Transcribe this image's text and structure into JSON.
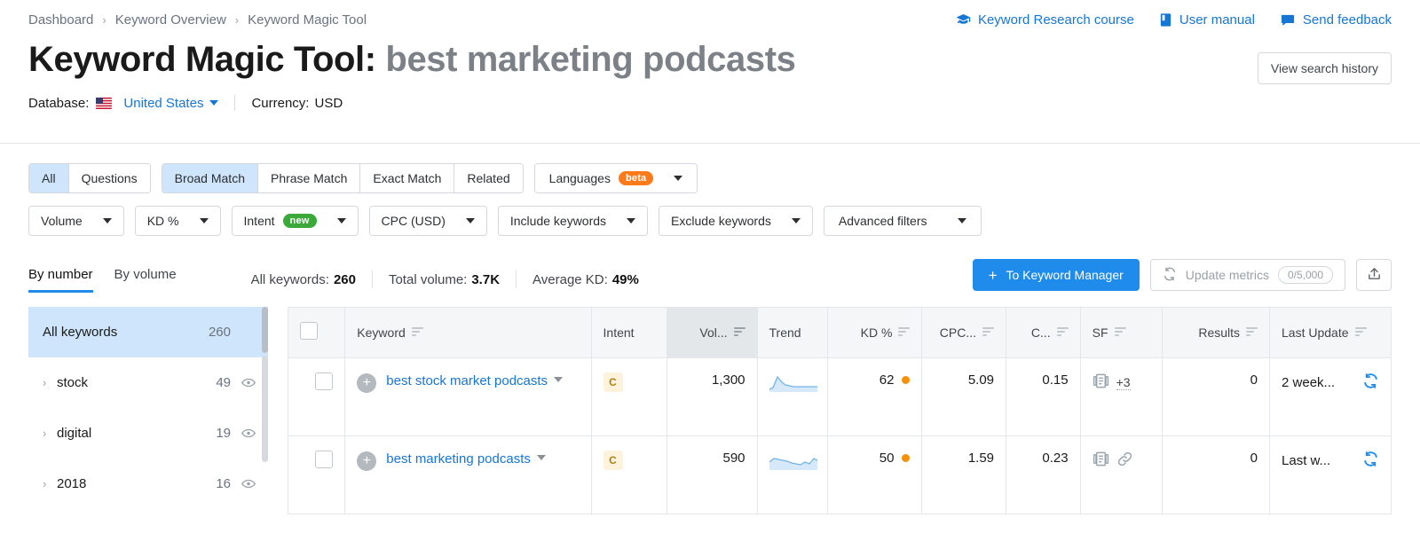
{
  "breadcrumb": {
    "items": [
      {
        "label": "Dashboard"
      },
      {
        "label": "Keyword Overview"
      },
      {
        "label": "Keyword Magic Tool"
      }
    ],
    "separator": "›"
  },
  "top_links": [
    {
      "label": "Keyword Research course",
      "icon": "graduation-cap-icon"
    },
    {
      "label": "User manual",
      "icon": "book-icon"
    },
    {
      "label": "Send feedback",
      "icon": "chat-bubble-icon"
    }
  ],
  "header": {
    "title_label": "Keyword Magic Tool:",
    "title_query": "best marketing podcasts",
    "search_history_button": "View search history",
    "database_label": "Database:",
    "database_value": "United States",
    "currency_label": "Currency:",
    "currency_value": "USD"
  },
  "filters": {
    "match_left": [
      {
        "label": "All",
        "active": true
      },
      {
        "label": "Questions",
        "active": false
      }
    ],
    "match_types": [
      {
        "label": "Broad Match",
        "active": true
      },
      {
        "label": "Phrase Match",
        "active": false
      },
      {
        "label": "Exact Match",
        "active": false
      },
      {
        "label": "Related",
        "active": false
      }
    ],
    "languages": {
      "label": "Languages",
      "badge": "beta"
    },
    "dropdowns": [
      {
        "label": "Volume"
      },
      {
        "label": "KD %",
        "badge": null
      },
      {
        "label": "Intent",
        "badge": "new"
      },
      {
        "label": "CPC (USD)"
      },
      {
        "label": "Include keywords"
      },
      {
        "label": "Exclude keywords"
      },
      {
        "label": "Advanced filters"
      }
    ]
  },
  "toolbar": {
    "view_tabs": [
      {
        "label": "By number",
        "active": true
      },
      {
        "label": "By volume",
        "active": false
      }
    ],
    "stats": [
      {
        "label": "All keywords:",
        "value": "260"
      },
      {
        "label": "Total volume:",
        "value": "3.7K"
      },
      {
        "label": "Average KD:",
        "value": "49%"
      }
    ],
    "keyword_manager_button": "To Keyword Manager",
    "update_metrics_button": "Update metrics",
    "update_metrics_count": "0/5,000",
    "export_icon": "export-icon"
  },
  "sidebar": {
    "items": [
      {
        "label": "All keywords",
        "count": "260",
        "selected": true,
        "expandable": false,
        "eye": false
      },
      {
        "label": "stock",
        "count": "49",
        "selected": false,
        "expandable": true,
        "eye": true
      },
      {
        "label": "digital",
        "count": "19",
        "selected": false,
        "expandable": true,
        "eye": true
      },
      {
        "label": "2018",
        "count": "16",
        "selected": false,
        "expandable": true,
        "eye": true
      }
    ]
  },
  "table": {
    "columns": [
      {
        "key": "checkbox",
        "label": "",
        "sortable": false,
        "align": "left",
        "sorted": false
      },
      {
        "key": "keyword",
        "label": "Keyword",
        "sortable": true,
        "align": "left",
        "sorted": false
      },
      {
        "key": "intent",
        "label": "Intent",
        "sortable": false,
        "align": "left",
        "sorted": false
      },
      {
        "key": "volume",
        "label": "Vol...",
        "sortable": true,
        "align": "right",
        "sorted": true
      },
      {
        "key": "trend",
        "label": "Trend",
        "sortable": false,
        "align": "left",
        "sorted": false
      },
      {
        "key": "kd",
        "label": "KD %",
        "sortable": true,
        "align": "right",
        "sorted": false
      },
      {
        "key": "cpc",
        "label": "CPC...",
        "sortable": true,
        "align": "right",
        "sorted": false
      },
      {
        "key": "com",
        "label": "C...",
        "sortable": true,
        "align": "right",
        "sorted": false
      },
      {
        "key": "sf",
        "label": "SF",
        "sortable": true,
        "align": "left",
        "sorted": false
      },
      {
        "key": "results",
        "label": "Results",
        "sortable": true,
        "align": "right",
        "sorted": false
      },
      {
        "key": "last_update",
        "label": "Last Update",
        "sortable": true,
        "align": "left",
        "sorted": false
      }
    ],
    "rows": [
      {
        "keyword": "best stock market podcasts",
        "intent": "C",
        "volume": "1,300",
        "kd": "62",
        "cpc": "5.09",
        "com": "0.15",
        "sf_icons": [
          "carousel-icon"
        ],
        "sf_extra": "+3",
        "results": "0",
        "last_update": "2 week...",
        "trend": [
          12,
          18,
          62,
          40,
          30,
          26,
          25,
          25,
          24,
          24,
          24,
          24
        ]
      },
      {
        "keyword": "best marketing podcasts",
        "intent": "C",
        "volume": "590",
        "kd": "50",
        "cpc": "1.59",
        "com": "0.23",
        "sf_icons": [
          "carousel-icon",
          "link-icon"
        ],
        "sf_extra": null,
        "results": "0",
        "last_update": "Last w...",
        "trend": [
          38,
          46,
          44,
          42,
          40,
          36,
          30,
          28,
          34,
          30,
          44,
          40
        ]
      }
    ]
  },
  "colors": {
    "accent_blue": "#1f8ceb",
    "link_blue": "#1576d4",
    "selected_blue": "#cfe5fb",
    "beta_orange": "#ff7a18",
    "new_green": "#3aa93a",
    "kd_dot_orange": "#f79009",
    "intent_badge_bg": "#fdf3dd",
    "intent_badge_fg": "#b07f13"
  }
}
